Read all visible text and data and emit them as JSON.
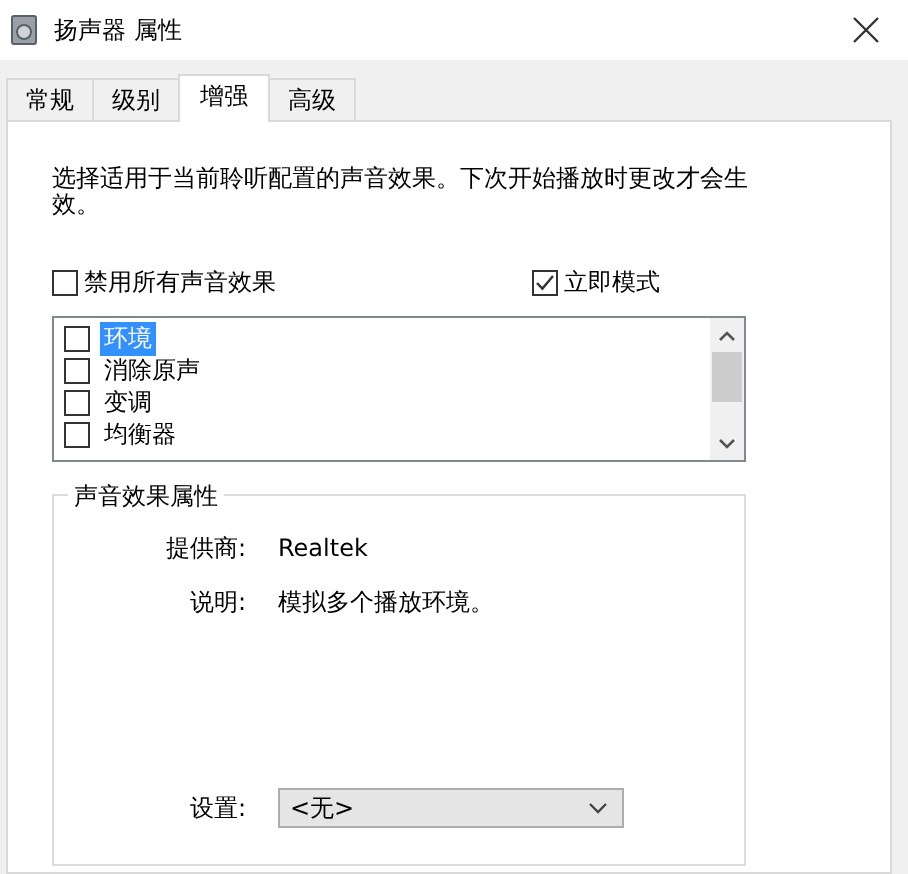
{
  "window": {
    "title": "扬声器 属性"
  },
  "tabs": [
    {
      "label": "常规",
      "selected": false
    },
    {
      "label": "级别",
      "selected": false
    },
    {
      "label": "增强",
      "selected": true
    },
    {
      "label": "高级",
      "selected": false
    }
  ],
  "intro": "选择适用于当前聆听配置的声音效果。下次开始播放时更改才会生效。",
  "options": [
    {
      "label": "禁用所有声音效果",
      "checked": false
    },
    {
      "label": "立即模式",
      "checked": true
    }
  ],
  "effects": [
    {
      "label": "环境",
      "checked": false,
      "selected": true
    },
    {
      "label": "消除原声",
      "checked": false,
      "selected": false
    },
    {
      "label": "变调",
      "checked": false,
      "selected": false
    },
    {
      "label": "均衡器",
      "checked": false,
      "selected": false
    }
  ],
  "properties": {
    "title": "声音效果属性",
    "provider_label": "提供商:",
    "provider": "Realtek",
    "description_label": "说明:",
    "description": "模拟多个播放环境。",
    "setting_label": "设置:",
    "setting": "<无>"
  }
}
